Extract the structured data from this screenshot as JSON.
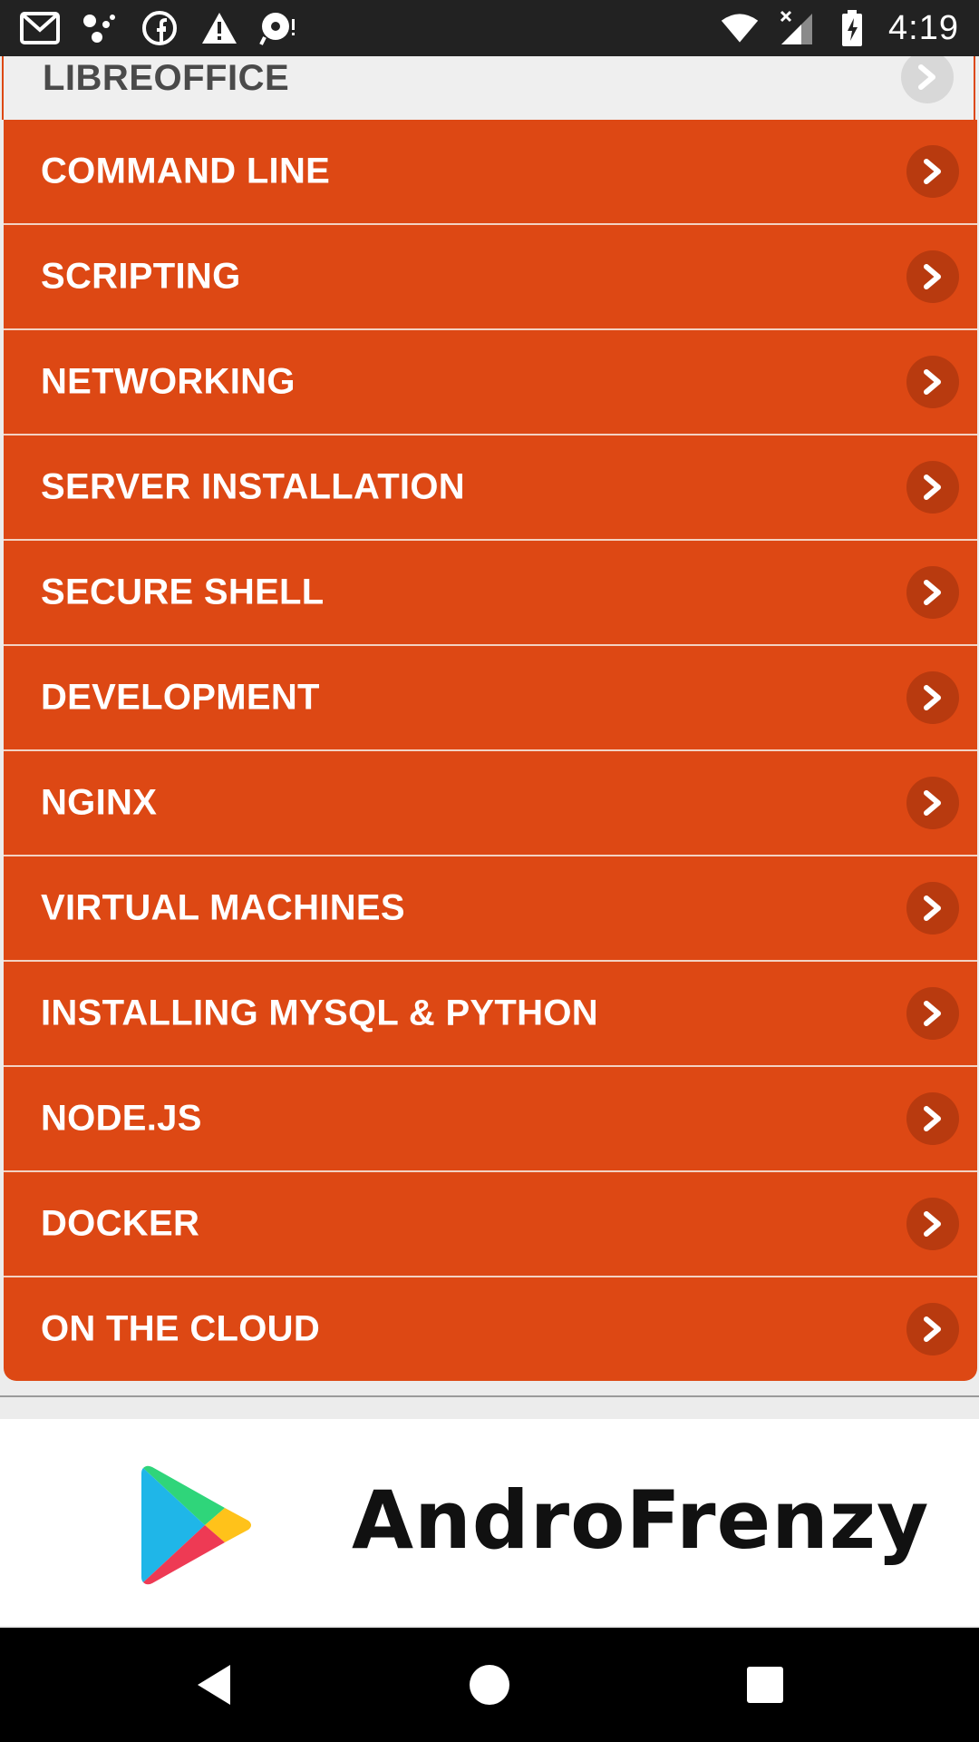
{
  "status_bar": {
    "time": "4:19",
    "left_icons": [
      "gmail-icon",
      "assistant-icon",
      "facebook-icon",
      "warning-icon",
      "podcast-icon"
    ],
    "right_icons": [
      "wifi-icon",
      "signal-icon",
      "battery-icon"
    ]
  },
  "menu": {
    "partial_item": "LIBREOFFICE",
    "items": [
      "COMMAND LINE",
      "SCRIPTING",
      "NETWORKING",
      "SERVER INSTALLATION",
      "SECURE SHELL",
      "DEVELOPMENT",
      "NGINX",
      "VIRTUAL MACHINES",
      "INSTALLING MYSQL & PYTHON",
      "NODE.JS",
      "DOCKER",
      "ON THE CLOUD"
    ]
  },
  "ad": {
    "brand": "AndroFrenzy",
    "logo": "play-store-icon"
  },
  "nav": {
    "buttons": [
      "back-icon",
      "home-icon",
      "recents-icon"
    ]
  },
  "colors": {
    "accent": "#dd4814",
    "chevron_bg": "#b83a0f",
    "status_bar": "#222222"
  }
}
